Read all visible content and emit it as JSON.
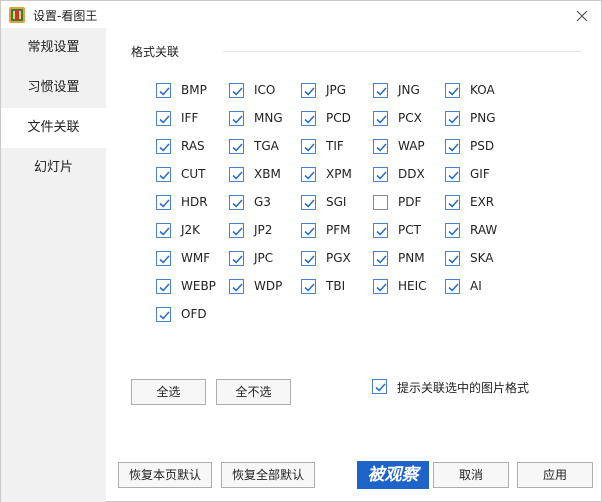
{
  "window": {
    "title": "设置-看图王",
    "icon": "app-logo-icon",
    "close_icon": "close-icon"
  },
  "sidebar": {
    "items": [
      {
        "label": "常规设置",
        "active": false
      },
      {
        "label": "习惯设置",
        "active": false
      },
      {
        "label": "文件关联",
        "active": true
      },
      {
        "label": "幻灯片",
        "active": false
      }
    ]
  },
  "section": {
    "title": "格式关联"
  },
  "formats": [
    {
      "label": "BMP",
      "checked": true
    },
    {
      "label": "ICO",
      "checked": true
    },
    {
      "label": "JPG",
      "checked": true
    },
    {
      "label": "JNG",
      "checked": true
    },
    {
      "label": "KOA",
      "checked": true
    },
    {
      "label": "IFF",
      "checked": true
    },
    {
      "label": "MNG",
      "checked": true
    },
    {
      "label": "PCD",
      "checked": true
    },
    {
      "label": "PCX",
      "checked": true
    },
    {
      "label": "PNG",
      "checked": true
    },
    {
      "label": "RAS",
      "checked": true
    },
    {
      "label": "TGA",
      "checked": true
    },
    {
      "label": "TIF",
      "checked": true
    },
    {
      "label": "WAP",
      "checked": true
    },
    {
      "label": "PSD",
      "checked": true
    },
    {
      "label": "CUT",
      "checked": true
    },
    {
      "label": "XBM",
      "checked": true
    },
    {
      "label": "XPM",
      "checked": true
    },
    {
      "label": "DDX",
      "checked": true
    },
    {
      "label": "GIF",
      "checked": true
    },
    {
      "label": "HDR",
      "checked": true
    },
    {
      "label": "G3",
      "checked": true
    },
    {
      "label": "SGI",
      "checked": true
    },
    {
      "label": "PDF",
      "checked": false
    },
    {
      "label": "EXR",
      "checked": true
    },
    {
      "label": "J2K",
      "checked": true
    },
    {
      "label": "JP2",
      "checked": true
    },
    {
      "label": "PFM",
      "checked": true
    },
    {
      "label": "PCT",
      "checked": true
    },
    {
      "label": "RAW",
      "checked": true
    },
    {
      "label": "WMF",
      "checked": true
    },
    {
      "label": "JPC",
      "checked": true
    },
    {
      "label": "PGX",
      "checked": true
    },
    {
      "label": "PNM",
      "checked": true
    },
    {
      "label": "SKA",
      "checked": true
    },
    {
      "label": "WEBP",
      "checked": true
    },
    {
      "label": "WDP",
      "checked": true
    },
    {
      "label": "TBI",
      "checked": true
    },
    {
      "label": "HEIC",
      "checked": true
    },
    {
      "label": "AI",
      "checked": true
    },
    {
      "label": "OFD",
      "checked": true
    }
  ],
  "actions": {
    "select_all": "全选",
    "select_none": "全不选",
    "prompt_assoc_label": "提示关联选中的图片格式",
    "prompt_assoc_checked": true,
    "restore_page": "恢复本页默认",
    "restore_all": "恢复全部默认",
    "cancel": "取消",
    "apply": "应用"
  },
  "watermark": {
    "text": "被观察"
  },
  "colors": {
    "checkbox_check": "#2f6fc4",
    "sidebar_bg": "#f1f1f1",
    "watermark_bg": "#1e63c8"
  }
}
